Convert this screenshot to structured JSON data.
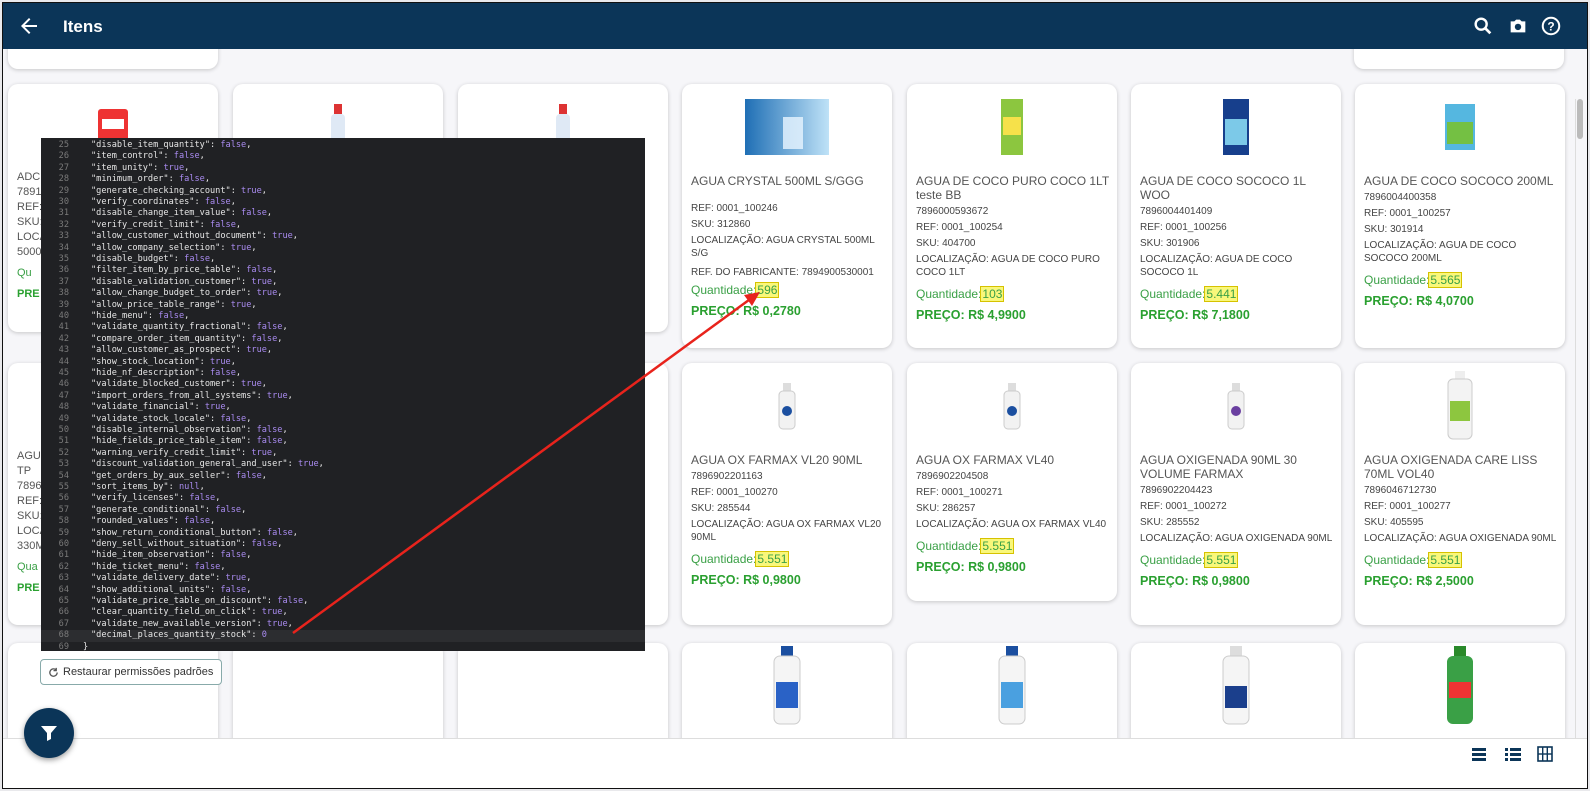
{
  "appbar": {
    "title": "Itens",
    "back_icon": "arrow-back-icon",
    "icons": [
      "search-icon",
      "camera-icon",
      "help-icon"
    ],
    "color": "#0b3558"
  },
  "products": [
    {
      "name": "AGUA CRYSTAL 500ML S/GGG",
      "ean": "",
      "ref": "REF: 0001_100246",
      "sku": "SKU: 312860",
      "location": "LOCALIZAÇÃO: AGUA CRYSTAL 500ML S/G",
      "manufacturer_ref": "REF. DO FABRICANTE: 7894900530001",
      "qty_label": "Quantidade:",
      "qty": "596",
      "price": "PREÇO: R$ 0,2780"
    },
    {
      "name": "AGUA DE COCO PURO COCO 1LT teste BB",
      "ean": "7896000593672",
      "ref": "REF: 0001_100254",
      "sku": "SKU: 404700",
      "location": "LOCALIZAÇÃO: AGUA DE COCO PURO COCO 1LT",
      "qty_label": "Quantidade:",
      "qty": "103",
      "price": "PREÇO: R$ 4,9900"
    },
    {
      "name": "AGUA DE COCO SOCOCO 1L WOO",
      "ean": "7896004401409",
      "ref": "REF: 0001_100256",
      "sku": "SKU: 301906",
      "location": "LOCALIZAÇÃO: AGUA DE COCO SOCOCO 1L",
      "qty_label": "Quantidade:",
      "qty": "5.441",
      "price": "PREÇO: R$ 7,1800"
    },
    {
      "name": "AGUA DE COCO SOCOCO 200ML",
      "ean": "7896004400358",
      "ref": "REF: 0001_100257",
      "sku": "SKU: 301914",
      "location": "LOCALIZAÇÃO: AGUA DE COCO SOCOCO 200ML",
      "qty_label": "Quantidade:",
      "qty": "5.565",
      "price": "PREÇO: R$ 4,0700"
    },
    {
      "name": "AGUA OX FARMAX VL20 90ML",
      "ean": "7896902201163",
      "ref": "REF: 0001_100270",
      "sku": "SKU: 285544",
      "location": "LOCALIZAÇÃO: AGUA OX FARMAX VL20 90ML",
      "qty_label": "Quantidade:",
      "qty": "5.551",
      "price": "PREÇO: R$ 0,9800"
    },
    {
      "name": "AGUA OX FARMAX VL40",
      "ean": "7896902204508",
      "ref": "REF: 0001_100271",
      "sku": "SKU: 286257",
      "location": "LOCALIZAÇÃO: AGUA OX FARMAX VL40",
      "qty_label": "Quantidade:",
      "qty": "5.551",
      "price": "PREÇO: R$ 0,9800"
    },
    {
      "name": "AGUA OXIGENADA 90ML 30 VOLUME FARMAX",
      "ean": "7896902204423",
      "ref": "REF: 0001_100272",
      "sku": "SKU: 285552",
      "location": "LOCALIZAÇÃO: AGUA OXIGENADA 90ML",
      "qty_label": "Quantidade:",
      "qty": "5.551",
      "price": "PREÇO: R$ 0,9800"
    },
    {
      "name": "AGUA OXIGENADA CARE LISS 70ML VOL40",
      "ean": "7896046712730",
      "ref": "REF: 0001_100277",
      "sku": "SKU: 405595",
      "location": "LOCALIZAÇÃO: AGUA OXIGENADA 90ML",
      "qty_label": "Quantidade:",
      "qty": "5.551",
      "price": "PREÇO: R$ 2,5000"
    }
  ],
  "left_partial": {
    "row1": [
      "ADC",
      "7891",
      "REF:",
      "SKU:",
      "LOCA",
      "5000",
      "Qu",
      "PRE"
    ],
    "row2": [
      "AGU",
      "TP",
      "7896",
      "REF:",
      "SKU:",
      "LOCA",
      "330M",
      "Qua",
      "PRE"
    ]
  },
  "code_lines": [
    {
      "n": "25",
      "k": "\"disable_item_quantity\"",
      "v": "false"
    },
    {
      "n": "26",
      "k": "\"item_control\"",
      "v": "false"
    },
    {
      "n": "27",
      "k": "\"item_unity\"",
      "v": "true"
    },
    {
      "n": "28",
      "k": "\"minimum_order\"",
      "v": "false"
    },
    {
      "n": "29",
      "k": "\"generate_checking_account\"",
      "v": "true"
    },
    {
      "n": "30",
      "k": "\"verify_coordinates\"",
      "v": "false"
    },
    {
      "n": "31",
      "k": "\"disable_change_item_value\"",
      "v": "false"
    },
    {
      "n": "32",
      "k": "\"verify_credit_limit\"",
      "v": "false"
    },
    {
      "n": "33",
      "k": "\"allow_customer_without_document\"",
      "v": "true"
    },
    {
      "n": "34",
      "k": "\"allow_company_selection\"",
      "v": "true"
    },
    {
      "n": "35",
      "k": "\"disable_budget\"",
      "v": "false"
    },
    {
      "n": "36",
      "k": "\"filter_item_by_price_table\"",
      "v": "false"
    },
    {
      "n": "37",
      "k": "\"disable_validation_customer\"",
      "v": "true"
    },
    {
      "n": "38",
      "k": "\"allow_change_budget_to_order\"",
      "v": "true"
    },
    {
      "n": "39",
      "k": "\"allow_price_table_range\"",
      "v": "true"
    },
    {
      "n": "40",
      "k": "\"hide_menu\"",
      "v": "false"
    },
    {
      "n": "41",
      "k": "\"validate_quantity_fractional\"",
      "v": "false"
    },
    {
      "n": "42",
      "k": "\"compare_order_item_quantity\"",
      "v": "false"
    },
    {
      "n": "43",
      "k": "\"allow_customer_as_prospect\"",
      "v": "true"
    },
    {
      "n": "44",
      "k": "\"show_stock_location\"",
      "v": "true"
    },
    {
      "n": "45",
      "k": "\"hide_nf_description\"",
      "v": "false"
    },
    {
      "n": "46",
      "k": "\"validate_blocked_customer\"",
      "v": "true"
    },
    {
      "n": "47",
      "k": "\"import_orders_from_all_systems\"",
      "v": "true"
    },
    {
      "n": "48",
      "k": "\"validate_financial\"",
      "v": "true"
    },
    {
      "n": "49",
      "k": "\"validate_stock_locale\"",
      "v": "false"
    },
    {
      "n": "50",
      "k": "\"disable_internal_observation\"",
      "v": "false"
    },
    {
      "n": "51",
      "k": "\"hide_fields_price_table_item\"",
      "v": "false"
    },
    {
      "n": "52",
      "k": "\"warning_verify_credit_limit\"",
      "v": "true"
    },
    {
      "n": "53",
      "k": "\"discount_validation_general_and_user\"",
      "v": "true"
    },
    {
      "n": "54",
      "k": "\"get_orders_by_aux_seller\"",
      "v": "false"
    },
    {
      "n": "55",
      "k": "\"sort_items_by\"",
      "v": "null"
    },
    {
      "n": "56",
      "k": "\"verify_licenses\"",
      "v": "false"
    },
    {
      "n": "57",
      "k": "\"generate_conditional\"",
      "v": "false"
    },
    {
      "n": "58",
      "k": "\"rounded_values\"",
      "v": "false"
    },
    {
      "n": "59",
      "k": "\"show_return_conditional_button\"",
      "v": "false"
    },
    {
      "n": "60",
      "k": "\"deny_sell_without_situation\"",
      "v": "false"
    },
    {
      "n": "61",
      "k": "\"hide_item_observation\"",
      "v": "false"
    },
    {
      "n": "62",
      "k": "\"hide_ticket_menu\"",
      "v": "false"
    },
    {
      "n": "63",
      "k": "\"validate_delivery_date\"",
      "v": "true"
    },
    {
      "n": "64",
      "k": "\"show_additional_units\"",
      "v": "false"
    },
    {
      "n": "65",
      "k": "\"validate_price_table_on_discount\"",
      "v": "false"
    },
    {
      "n": "66",
      "k": "\"clear_quantity_field_on_click\"",
      "v": "true"
    },
    {
      "n": "67",
      "k": "\"validate_new_available_version\"",
      "v": "true"
    },
    {
      "n": "68",
      "k": "\"decimal_places_quantity_stock\"",
      "v": "0"
    },
    {
      "n": "69",
      "k": "}",
      "v": ""
    }
  ],
  "restore_button": "Restaurar permissões padrões",
  "fab_icon": "filter-icon",
  "view_icons": [
    "list-compact-icon",
    "list-icon",
    "grid-icon"
  ],
  "colors": {
    "accent": "#0b3558",
    "qty_green": "#3aa046",
    "highlight": "#f9f77a",
    "arrow": "#e8231c"
  }
}
